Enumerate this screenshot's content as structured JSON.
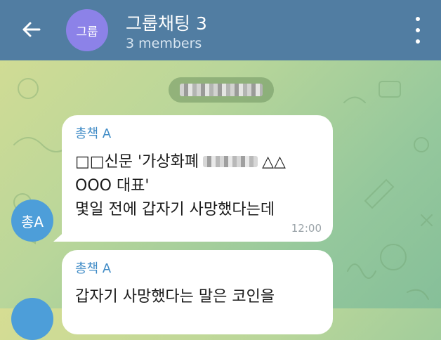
{
  "header": {
    "title": "그룹채팅 3",
    "subtitle": "3 members",
    "avatar_text": "그룹",
    "colors": {
      "bar": "#517da2",
      "group_avatar": "#8c82e8"
    }
  },
  "messages": [
    {
      "sender": "총책 A",
      "lines": [
        "□□신문 '가상화폐",
        "△△",
        "OOO 대표'",
        "몇일 전에 갑자기 사망했다는데"
      ],
      "time": "12:00"
    },
    {
      "sender": "총책 A",
      "lines": [
        "갑자기 사망했다는 말은 코인을"
      ]
    }
  ],
  "user_avatar": {
    "text": "총A",
    "color": "#4d9ed9"
  }
}
